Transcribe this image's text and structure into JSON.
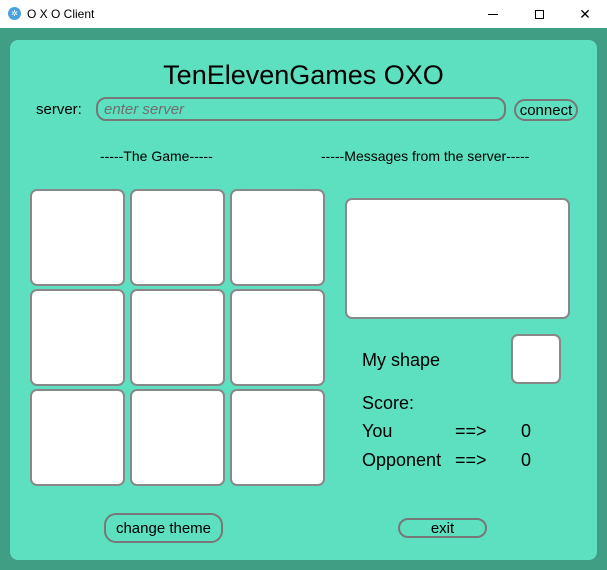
{
  "window": {
    "title": "O X O Client",
    "icon": "app-icon",
    "controls": [
      "minimize-icon",
      "maximize-icon",
      "close-icon"
    ],
    "close_glyph": "✕"
  },
  "header": {
    "title": "TenElevenGames OXO"
  },
  "server": {
    "label": "server:",
    "placeholder": "enter server",
    "value": "",
    "connect_label": "connect"
  },
  "game": {
    "heading": "-----The Game-----",
    "cells": [
      "",
      "",
      "",
      "",
      "",
      "",
      "",
      "",
      ""
    ]
  },
  "messages": {
    "heading": "-----Messages from the server-----",
    "content": ""
  },
  "my_shape": {
    "label": "My shape",
    "value": ""
  },
  "score": {
    "label": "Score:",
    "rows": [
      {
        "name": "You",
        "arrow": "==>",
        "value": "0"
      },
      {
        "name": "Opponent",
        "arrow": "==>",
        "value": "0"
      }
    ]
  },
  "footer": {
    "change_theme_label": "change theme",
    "exit_label": "exit"
  },
  "colors": {
    "panel": "#5de0c0",
    "background": "#3f9e83",
    "cell": "#ffffff",
    "border": "#888888"
  }
}
